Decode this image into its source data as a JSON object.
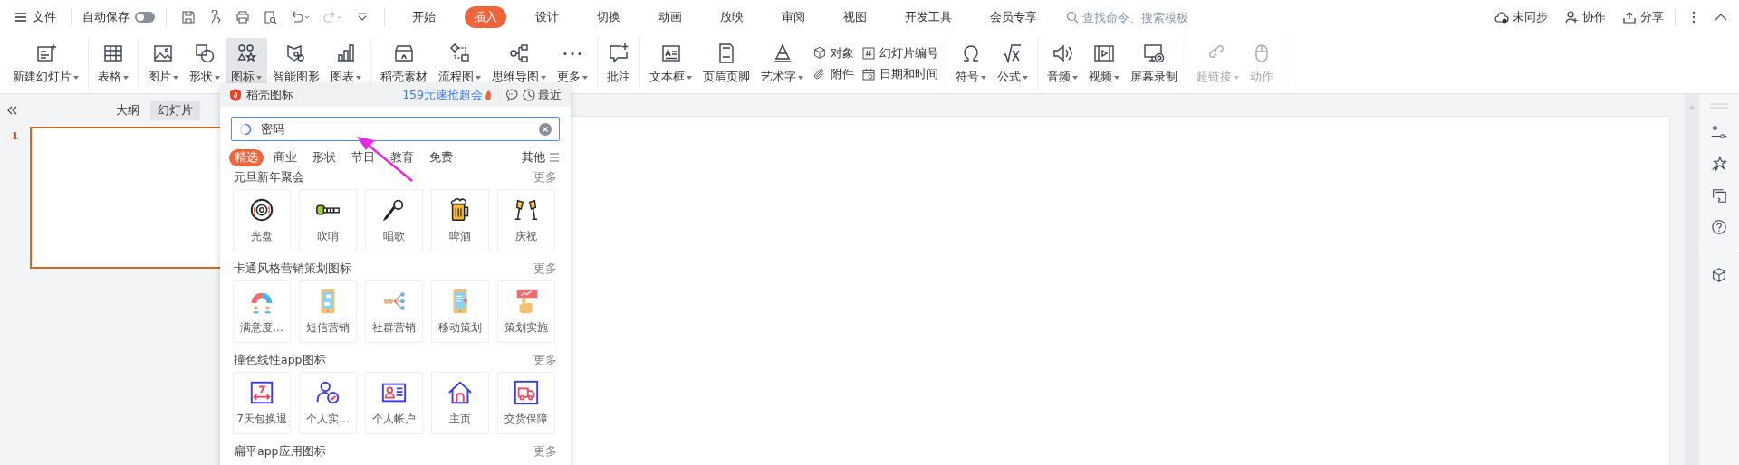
{
  "menu": {
    "label": "文件"
  },
  "autosave": {
    "label": "自动保存",
    "on": false
  },
  "tabs": [
    {
      "label": "开始",
      "selected": false
    },
    {
      "label": "插入",
      "selected": true
    },
    {
      "label": "设计",
      "selected": false
    },
    {
      "label": "切换",
      "selected": false
    },
    {
      "label": "动画",
      "selected": false
    },
    {
      "label": "放映",
      "selected": false
    },
    {
      "label": "审阅",
      "selected": false
    },
    {
      "label": "视图",
      "selected": false
    },
    {
      "label": "开发工具",
      "selected": false
    },
    {
      "label": "会员专享",
      "selected": false
    }
  ],
  "search": {
    "placeholder": "查找命令、搜索模板"
  },
  "account": [
    {
      "label": "未同步"
    },
    {
      "label": "协作"
    },
    {
      "label": "分享"
    }
  ],
  "ribbon": [
    {
      "tools": [
        {
          "kind": "large",
          "label": "新建幻灯片",
          "dropdown": true,
          "selected": false,
          "disabled": false
        }
      ]
    },
    {
      "tools": [
        {
          "kind": "large",
          "label": "表格",
          "dropdown": true,
          "selected": false,
          "disabled": false
        }
      ]
    },
    {
      "tools": [
        {
          "kind": "large",
          "label": "图片",
          "dropdown": true,
          "selected": false,
          "disabled": false
        },
        {
          "kind": "large",
          "label": "形状",
          "dropdown": true,
          "selected": false,
          "disabled": false
        },
        {
          "kind": "large",
          "label": "图标",
          "dropdown": true,
          "selected": true,
          "disabled": false
        },
        {
          "kind": "large",
          "label": "智能图形",
          "dropdown": false,
          "selected": false,
          "disabled": false
        },
        {
          "kind": "large",
          "label": "图表",
          "dropdown": true,
          "selected": false,
          "disabled": false
        }
      ]
    },
    {
      "tools": [
        {
          "kind": "large",
          "label": "稻壳素材",
          "dropdown": false,
          "selected": false,
          "disabled": false
        },
        {
          "kind": "large",
          "label": "流程图",
          "dropdown": true,
          "selected": false,
          "disabled": false
        },
        {
          "kind": "large",
          "label": "思维导图",
          "dropdown": true,
          "selected": false,
          "disabled": false
        },
        {
          "kind": "large",
          "label": "更多",
          "dropdown": true,
          "selected": false,
          "disabled": false
        }
      ]
    },
    {
      "tools": [
        {
          "kind": "large",
          "label": "批注",
          "dropdown": false,
          "selected": false,
          "disabled": false
        }
      ]
    },
    {
      "tools": [
        {
          "kind": "large",
          "label": "文本框",
          "dropdown": true,
          "selected": false,
          "disabled": false
        },
        {
          "kind": "large",
          "label": "页眉页脚",
          "dropdown": false,
          "selected": false,
          "disabled": false
        },
        {
          "kind": "large",
          "label": "艺术字",
          "dropdown": true,
          "selected": false,
          "disabled": false
        },
        {
          "kind": "stack",
          "items": [
            {
              "label": "对象"
            },
            {
              "label": "附件"
            }
          ]
        },
        {
          "kind": "stack",
          "items": [
            {
              "label": "幻灯片编号"
            },
            {
              "label": "日期和时间"
            }
          ]
        }
      ]
    },
    {
      "tools": [
        {
          "kind": "large",
          "label": "符号",
          "dropdown": true,
          "selected": false,
          "disabled": false
        },
        {
          "kind": "large",
          "label": "公式",
          "dropdown": true,
          "selected": false,
          "disabled": false
        }
      ]
    },
    {
      "tools": [
        {
          "kind": "large",
          "label": "音频",
          "dropdown": true,
          "selected": false,
          "disabled": false
        },
        {
          "kind": "large",
          "label": "视频",
          "dropdown": true,
          "selected": false,
          "disabled": false
        },
        {
          "kind": "large",
          "label": "屏幕录制",
          "dropdown": false,
          "selected": false,
          "disabled": false
        }
      ]
    },
    {
      "tools": [
        {
          "kind": "large",
          "label": "超链接",
          "dropdown": true,
          "selected": false,
          "disabled": true
        },
        {
          "kind": "large",
          "label": "动作",
          "dropdown": false,
          "selected": false,
          "disabled": true
        }
      ]
    }
  ],
  "views": [
    {
      "label": "大纲",
      "selected": false
    },
    {
      "label": "幻灯片",
      "selected": true
    }
  ],
  "slides": [
    {
      "number": "1",
      "selected": true
    }
  ],
  "panel": {
    "brand": "稻壳图标",
    "promo": "159元速抢超会",
    "recent": "最近",
    "search": {
      "value": "密码"
    },
    "categories": [
      {
        "label": "精选",
        "selected": true
      },
      {
        "label": "商业",
        "selected": false
      },
      {
        "label": "形状",
        "selected": false
      },
      {
        "label": "节日",
        "selected": false
      },
      {
        "label": "教育",
        "selected": false
      },
      {
        "label": "免费",
        "selected": false
      }
    ],
    "other": "其他",
    "sections": [
      {
        "title": "元旦新年聚会",
        "more": "更多",
        "items": [
          {
            "label": "光盘"
          },
          {
            "label": "吹哨"
          },
          {
            "label": "唱歌"
          },
          {
            "label": "啤酒"
          },
          {
            "label": "庆祝"
          }
        ]
      },
      {
        "title": "卡通风格营销策划图标",
        "more": "更多",
        "items": [
          {
            "label": "满意度..."
          },
          {
            "label": "短信营销"
          },
          {
            "label": "社群营销"
          },
          {
            "label": "移动策划"
          },
          {
            "label": "策划实施"
          }
        ]
      },
      {
        "title": "撞色线性app图标",
        "more": "更多",
        "items": [
          {
            "label": "7天包换退"
          },
          {
            "label": "个人实..."
          },
          {
            "label": "个人帐户"
          },
          {
            "label": "主页"
          },
          {
            "label": "交货保障"
          }
        ]
      },
      {
        "title": "扁平app应用图标",
        "more": "更多"
      }
    ]
  }
}
